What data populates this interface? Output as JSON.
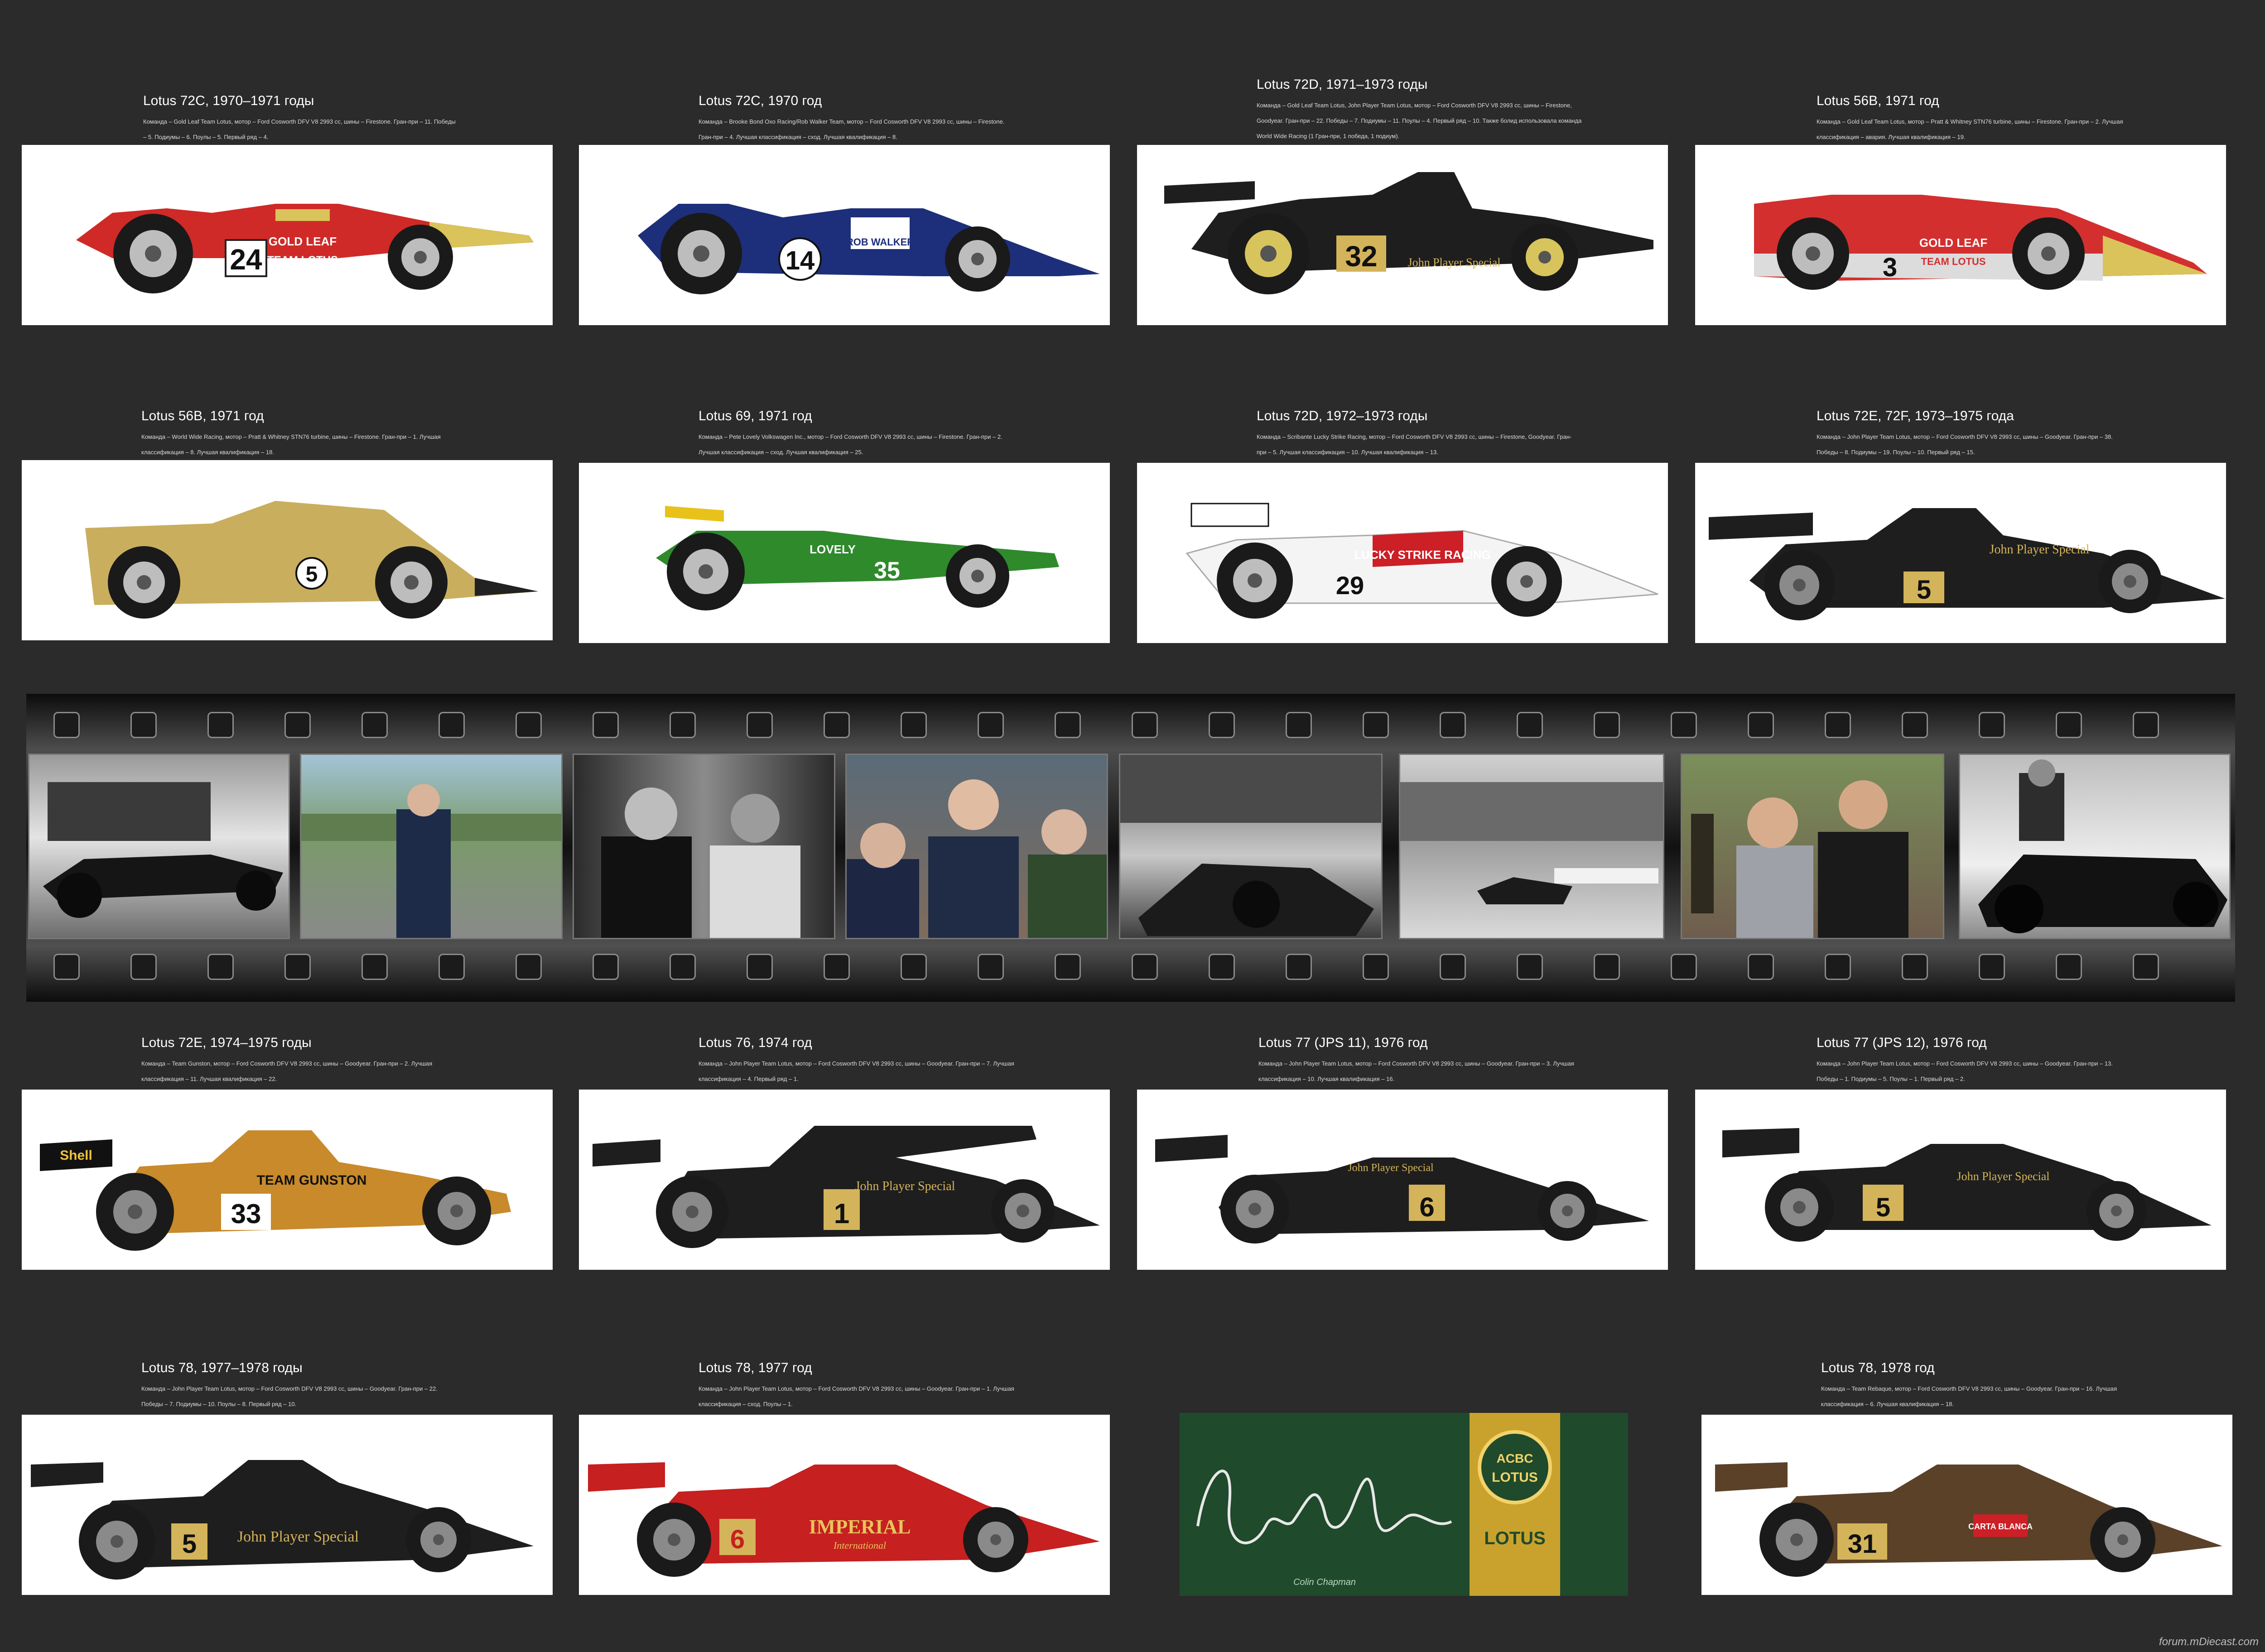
{
  "cards": [
    {
      "title": "Lotus 72C, 1970–1971 годы",
      "desc": "Команда – Gold Leaf Team Lotus, мотор – Ford Cosworth DFV V8 2993 cc, шины – Firestone. Гран-при – 11. Победы – 5. Подиумы – 6. Поулы – 5. Первый ряд – 4.",
      "number": "24",
      "sponsor": "GOLD LEAF",
      "team": "TEAM LOTUS",
      "body_color": "#cf2a27",
      "nose_color": "#d9c35a"
    },
    {
      "title": "Lotus 72C, 1970 год",
      "desc": "Команда – Brooke Bond Oxo Racing/Rob Walker Team, мотор – Ford Cosworth DFV V8 2993 cc, шины – Firestone. Гран-при – 4. Лучшая классификация – сход. Лучшая квалификация – 8.",
      "number": "14",
      "sponsor": "ROB WALKER",
      "team": "",
      "body_color": "#1d2f7a",
      "nose_color": "#1d2f7a"
    },
    {
      "title": "Lotus 72D, 1971–1973 годы",
      "desc": "Команда – Gold Leaf Team Lotus, John Player Team Lotus, мотор – Ford Cosworth DFV V8 2993 cc, шины – Firestone, Goodyear. Гран-при – 22. Победы – 7. Подиумы – 11. Поулы – 4. Первый ряд – 10. Также болид использовала команда World Wide Racing (1 Гран-при, 1 победа, 1 подиум).",
      "number": "32",
      "sponsor": "John Player Special",
      "team": "",
      "body_color": "#1e1e1e",
      "nose_color": "#1e1e1e"
    },
    {
      "title": "Lotus 56B, 1971 год",
      "desc": "Команда – Gold Leaf Team Lotus, мотор – Pratt & Whitney STN76 turbine, шины – Firestone. Гран-при – 2. Лучшая классификация – авария. Лучшая квалификация – 19.",
      "number": "3",
      "sponsor": "GOLD LEAF",
      "team": "TEAM LOTUS",
      "body_color": "#d32f2f",
      "nose_color": "#d9c35a"
    },
    {
      "title": "Lotus 56B, 1971 год",
      "desc": "Команда – World Wide Racing, мотор – Pratt & Whitney STN76 turbine, шины – Firestone. Гран-при – 1. Лучшая классификация – 8. Лучшая квалификация – 18.",
      "number": "5",
      "sponsor": "",
      "team": "",
      "body_color": "#c9ae5e",
      "nose_color": "#222222"
    },
    {
      "title": "Lotus 69, 1971 год",
      "desc": "Команда – Pete Lovely Volkswagen Inc., мотор – Ford Cosworth DFV V8 2993 cc, шины – Firestone. Гран-при – 2. Лучшая классификация – сход. Лучшая квалификация – 25.",
      "number": "35",
      "sponsor": "LOVELY",
      "team": "",
      "body_color": "#2f8a2c",
      "nose_color": "#2f8a2c"
    },
    {
      "title": "Lotus 72D, 1972–1973 годы",
      "desc": "Команда – Scribante Lucky Strike Racing, мотор – Ford Cosworth DFV V8 2993 cc, шины – Firestone, Goodyear. Гран-при – 5. Лучшая классификация – 10. Лучшая квалификация – 13.",
      "number": "29",
      "sponsor": "LUCKY STRIKE RACING",
      "team": "",
      "body_color": "#ffffff",
      "nose_color": "#c8c8c8"
    },
    {
      "title": "Lotus 72E, 72F, 1973–1975 года",
      "desc": "Команда – John Player Team Lotus, мотор – Ford Cosworth DFV V8 2993 cc, шины – Goodyear. Гран-при – 38. Победы – 8. Подиумы – 19. Поулы – 10. Первый ряд – 15.",
      "number": "5",
      "sponsor": "John Player Special",
      "team": "",
      "body_color": "#1e1e1e",
      "nose_color": "#1e1e1e"
    },
    {
      "title": "Lotus 72E, 1974–1975 годы",
      "desc": "Команда – Team Gunston, мотор – Ford Cosworth DFV V8 2993 cc, шины – Goodyear. Гран-при – 2. Лучшая классификация – 11. Лучшая квалификация – 22.",
      "number": "33",
      "sponsor": "TEAM GUNSTON",
      "team": "",
      "body_color": "#c88a2a",
      "nose_color": "#c88a2a"
    },
    {
      "title": "Lotus 76, 1974 год",
      "desc": "Команда – John Player Team Lotus, мотор – Ford Cosworth DFV V8 2993 cc, шины – Goodyear. Гран-при – 7. Лучшая классификация – 4. Первый ряд – 1.",
      "number": "1",
      "sponsor": "John Player Special",
      "team": "",
      "body_color": "#1e1e1e",
      "nose_color": "#1e1e1e"
    },
    {
      "title": "Lotus 77 (JPS 11), 1976 год",
      "desc": "Команда – John Player Team Lotus, мотор – Ford Cosworth DFV V8 2993 cc, шины – Goodyear. Гран-при – 3. Лучшая классификация – 10. Лучшая квалификация – 16.",
      "number": "6",
      "sponsor": "John Player Special",
      "team": "",
      "body_color": "#1e1e1e",
      "nose_color": "#1e1e1e"
    },
    {
      "title": "Lotus 77 (JPS 12), 1976 год",
      "desc": "Команда – John Player Team Lotus, мотор – Ford Cosworth DFV V8 2993 cc, шины – Goodyear. Гран-при – 13. Победы – 1. Подиумы – 5. Поулы – 1. Первый ряд – 2.",
      "number": "5",
      "sponsor": "John Player Special",
      "team": "",
      "body_color": "#1e1e1e",
      "nose_color": "#1e1e1e"
    },
    {
      "title": "Lotus 78, 1977–1978 годы",
      "desc": "Команда – John Player Team Lotus, мотор – Ford Cosworth DFV V8 2993 cc, шины – Goodyear. Гран-при – 22. Победы – 7. Подиумы – 10. Поулы – 8. Первый ряд – 10.",
      "number": "5",
      "sponsor": "John Player Special",
      "team": "",
      "body_color": "#1e1e1e",
      "nose_color": "#1e1e1e"
    },
    {
      "title": "Lotus 78, 1977 год",
      "desc": "Команда – John Player Team Lotus, мотор – Ford Cosworth DFV V8 2993 cc, шины – Goodyear. Гран-при – 1. Лучшая классификация – сход. Поулы – 1.",
      "number": "6",
      "sponsor": "IMPERIAL",
      "team": "International",
      "body_color": "#c62020",
      "nose_color": "#c62020"
    },
    {
      "title": "Lotus 78, 1978 год",
      "desc": "Команда – Team Rebaque, мотор – Ford Cosworth DFV V8 2993 cc, шины – Goodyear. Гран-при – 16. Лучшая классификация – 6. Лучшая квалификация – 18.",
      "number": "31",
      "sponsor": "CARTA BLANCA",
      "team": "",
      "body_color": "#5a4128",
      "nose_color": "#5a4128"
    }
  ],
  "plate": {
    "signature": "Colin Chapman",
    "logo_letters": "ACBC",
    "logo_word": "LOTUS",
    "brand": "LOTUS"
  },
  "watermark": "forum.mDiecast.com"
}
